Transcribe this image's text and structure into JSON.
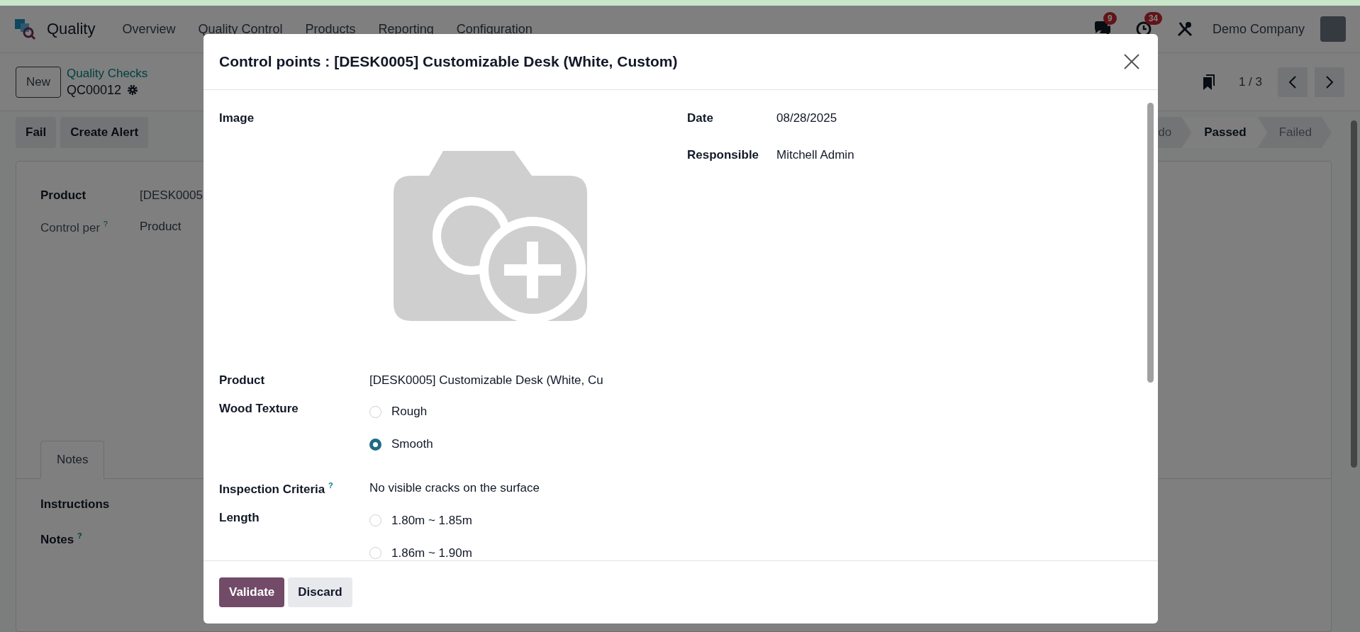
{
  "navbar": {
    "app_name": "Quality",
    "menu": [
      "Overview",
      "Quality Control",
      "Products",
      "Reporting",
      "Configuration"
    ],
    "messages_badge": "9",
    "activities_badge": "34",
    "company": "Demo Company"
  },
  "control_panel": {
    "new_button": "New",
    "breadcrumb": "Quality Checks",
    "record": "QC00012",
    "pager": "1 / 3"
  },
  "actions": [
    "Fail",
    "Create Alert"
  ],
  "statusbar": [
    {
      "label": "do",
      "selected": false
    },
    {
      "label": "Passed",
      "selected": true
    },
    {
      "label": "Failed",
      "selected": false
    }
  ],
  "form": {
    "fields": [
      {
        "label": "Product",
        "value": "[DESK0005",
        "disabled": false
      },
      {
        "label": "Control per",
        "help": "?",
        "value": "Product",
        "disabled": true
      }
    ],
    "tabs": [
      {
        "label": "Notes",
        "selected": true
      }
    ],
    "notes_fields": [
      {
        "label": "Instructions"
      },
      {
        "label": "Notes",
        "help": "?"
      }
    ]
  },
  "dialog": {
    "title": "Control points : [DESK0005] Customizable Desk (White, Custom)",
    "left_fields": [
      {
        "kind": "image",
        "label": "Image"
      },
      {
        "kind": "text",
        "label": "Product",
        "value": "[DESK0005] Customizable Desk (White, Cu"
      },
      {
        "kind": "radio",
        "label": "Wood Texture",
        "options": [
          {
            "label": "Rough",
            "selected": false
          },
          {
            "label": "Smooth",
            "selected": true
          }
        ]
      },
      {
        "kind": "text",
        "label": "Inspection Criteria",
        "help": "?",
        "value": "No visible cracks on the surface"
      },
      {
        "kind": "radio",
        "label": "Length",
        "options": [
          {
            "label": "1.80m ~ 1.85m",
            "selected": false
          },
          {
            "label": "1.86m ~ 1.90m",
            "selected": false
          }
        ]
      }
    ],
    "right_fields": [
      {
        "label": "Date",
        "value": "08/28/2025"
      },
      {
        "label": "Responsible",
        "value": "Mitchell Admin"
      }
    ],
    "buttons": [
      {
        "label": "Validate",
        "kind": "primary"
      },
      {
        "label": "Discard",
        "kind": "secondary"
      }
    ]
  }
}
